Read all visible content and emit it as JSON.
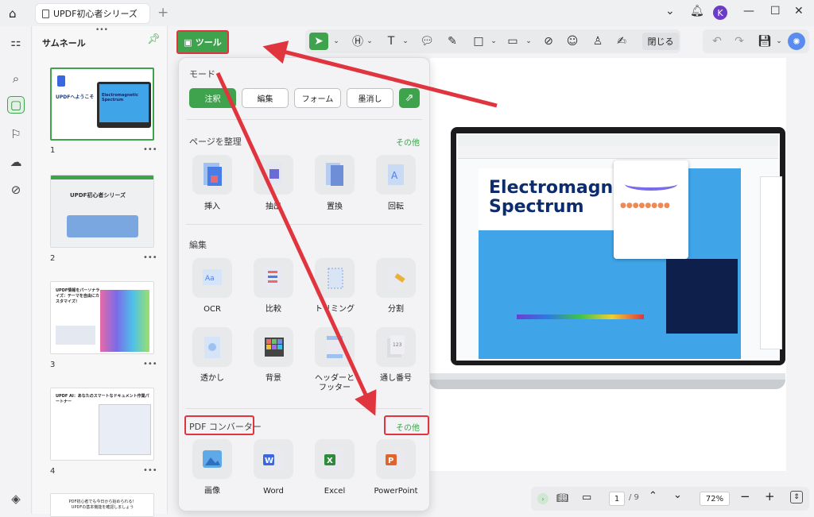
{
  "titlebar": {
    "tab_title": "UPDF初心者シリーズ",
    "user_initial": "K"
  },
  "thumbnails": {
    "title": "サムネール",
    "pages": [
      {
        "num": "1",
        "text": "UPDFへようこそ",
        "inner": "Electromagnetic Spectrum"
      },
      {
        "num": "2",
        "text": "UPDF初心者シリーズ"
      },
      {
        "num": "3",
        "text": "UPDF情報をパーソナライズ：テーマを自由にカスタマイズ！"
      },
      {
        "num": "4",
        "text": "UPDF AI：あなたのスマートなドキュメント作業パートナー"
      },
      {
        "num": "",
        "text": "PDF初心者でも今日から始められる！UPDFの基本機能を確認しましょう"
      }
    ]
  },
  "toolbar": {
    "tools_label": "ツール",
    "close_label": "閉じる"
  },
  "panel": {
    "mode_title": "モード",
    "modes": [
      "注釈",
      "編集",
      "フォーム",
      "墨消し"
    ],
    "organize_title": "ページを整理",
    "organize_more": "その他",
    "organize_items": [
      "挿入",
      "抽出",
      "置換",
      "回転"
    ],
    "edit_title": "編集",
    "edit_items": [
      "OCR",
      "比較",
      "トリミング",
      "分割"
    ],
    "edit_items2": [
      "透かし",
      "背景",
      "ヘッダーと\nフッター",
      "通し番号"
    ],
    "convert_title": "PDF コンバーター",
    "convert_more": "その他",
    "convert_items": [
      "画像",
      "Word",
      "Excel",
      "PowerPoint"
    ]
  },
  "document": {
    "title": "Electromagnetic Spectrum",
    "title_line1": "Electromagne",
    "title_line2": "Spectrum"
  },
  "pager": {
    "current": "1",
    "total": "/ 9",
    "zoom": "72%"
  },
  "colors": {
    "accent": "#3fa34d",
    "highlight": "#e0353f"
  }
}
